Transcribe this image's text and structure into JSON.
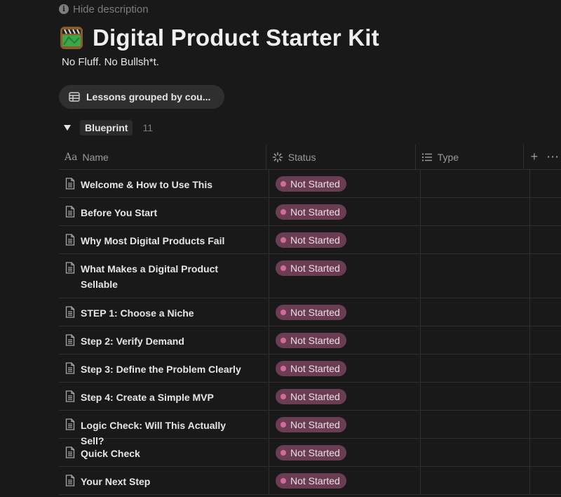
{
  "page": {
    "hide_description": "Hide description",
    "title": "Digital Product Starter Kit",
    "subtitle": "No Fluff. No Bullsh*t."
  },
  "view": {
    "label": "Lessons grouped by cou..."
  },
  "group": {
    "label": "Blueprint",
    "count": "11"
  },
  "columns": {
    "name": "Name",
    "status": "Status",
    "type": "Type"
  },
  "status_colors": {
    "badge_bg": "#6a3d53",
    "dot": "#d16b9b"
  },
  "rows": [
    {
      "name": "Welcome & How to Use This",
      "status": "Not Started"
    },
    {
      "name": "Before You Start",
      "status": "Not Started"
    },
    {
      "name": "Why Most Digital Products Fail",
      "status": "Not Started"
    },
    {
      "name": "What Makes a Digital Product Sellable",
      "status": "Not Started"
    },
    {
      "name": "STEP 1: Choose a Niche",
      "status": "Not Started"
    },
    {
      "name": "Step 2: Verify Demand",
      "status": "Not Started"
    },
    {
      "name": "Step 3: Define the Problem Clearly",
      "status": "Not Started"
    },
    {
      "name": "Step 4: Create a Simple MVP",
      "status": "Not Started"
    },
    {
      "name": "Logic Check: Will This Actually Sell?",
      "status": "Not Started"
    },
    {
      "name": "Quick Check",
      "status": "Not Started"
    },
    {
      "name": "Your Next Step",
      "status": "Not Started"
    }
  ]
}
